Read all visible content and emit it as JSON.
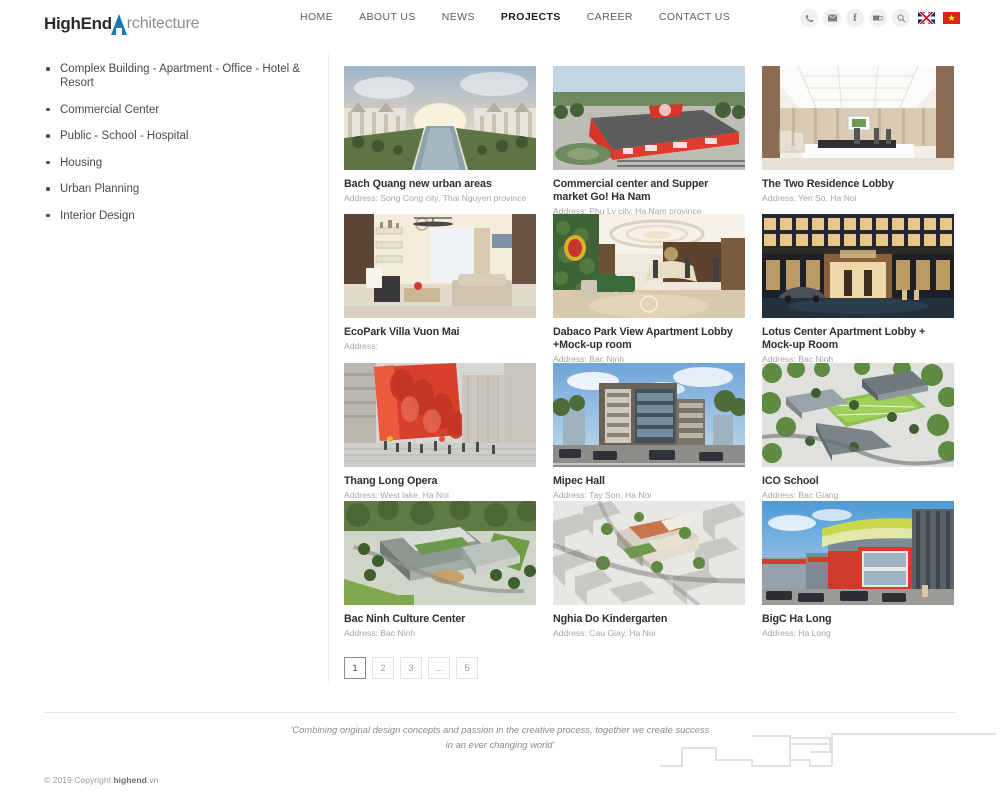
{
  "site": {
    "logo_primary": "HighEnd",
    "logo_secondary": "rchitecture",
    "logo_mark": "blue-triangle-a"
  },
  "nav": {
    "items": [
      {
        "label": "HOME",
        "active": false
      },
      {
        "label": "ABOUT US",
        "active": false
      },
      {
        "label": "NEWS",
        "active": false
      },
      {
        "label": "PROJECTS",
        "active": true
      },
      {
        "label": "CAREER",
        "active": false
      },
      {
        "label": "CONTACT US",
        "active": false
      }
    ]
  },
  "toolbar": {
    "icons": [
      {
        "name": "phone-icon",
        "glyph": "☎"
      },
      {
        "name": "email-icon",
        "glyph": "✉"
      },
      {
        "name": "facebook-icon",
        "glyph": "f"
      },
      {
        "name": "social-share-icon",
        "glyph": "✉"
      },
      {
        "name": "search-icon",
        "glyph": "⌕"
      }
    ],
    "flags": [
      {
        "name": "flag-en",
        "label": "EN"
      },
      {
        "name": "flag-vi",
        "label": "VI",
        "star": "★"
      }
    ]
  },
  "sidebar": {
    "items": [
      {
        "label": "Complex Building - Apartment - Office - Hotel & Resort"
      },
      {
        "label": "Commercial Center"
      },
      {
        "label": "Public - School - Hospital"
      },
      {
        "label": "Housing"
      },
      {
        "label": "Urban Planning"
      },
      {
        "label": "Interior Design"
      }
    ]
  },
  "projects": [
    {
      "title": "Bach Quang new urban areas",
      "address": "Address: Song Cong city, Thai Nguyen province",
      "image": "urban-boulevard-render"
    },
    {
      "title": "Commercial center and Supper market Go! Ha Nam",
      "address": "Address: Phu Ly city, Ha Nam province",
      "image": "red-shopping-mall-aerial"
    },
    {
      "title": "The Two Residence Lobby",
      "address": "Address: Yen So, Ha Noi",
      "image": "bright-reception-lobby"
    },
    {
      "title": "EcoPark Villa Vuon Mai",
      "address": "Address:",
      "image": "living-room-interior"
    },
    {
      "title": "Dabaco Park View Apartment Lobby +Mock-up room",
      "address": "Address: Bac Ninh",
      "image": "green-wall-lobby"
    },
    {
      "title": "Lotus Center Apartment Lobby + Mock-up Room",
      "address": "Address: Bac Ninh",
      "image": "night-building-facade"
    },
    {
      "title": "Thang Long Opera",
      "address": "Address: West lake, Ha Noi",
      "image": "red-opera-house"
    },
    {
      "title": "Mipec Hall",
      "address": "Address: Tay Son, Ha Noi",
      "image": "grey-office-building"
    },
    {
      "title": "ICO School",
      "address": "Address: Bac Giang",
      "image": "school-campus-aerial"
    },
    {
      "title": "Bac Ninh Culture Center",
      "address": "Address: Bac Ninh",
      "image": "culture-center-aerial"
    },
    {
      "title": "Nghia Do Kindergarten",
      "address": "Address: Cau Giay, Ha Noi",
      "image": "kindergarten-block-aerial"
    },
    {
      "title": "BigC Ha Long",
      "address": "Address: Ha Long",
      "image": "bigc-storefront"
    }
  ],
  "pagination": {
    "pages": [
      {
        "label": "1",
        "active": true
      },
      {
        "label": "2",
        "active": false
      },
      {
        "label": "3",
        "active": false
      },
      {
        "label": "...",
        "active": false
      },
      {
        "label": "5",
        "active": false
      }
    ]
  },
  "footer": {
    "tagline_line1": "'Combining original design concepts and passion in the creative process, together we create success",
    "tagline_line2": "in an ever changing world'",
    "copyright_prefix": "© 2019 Copyright ",
    "copyright_brand": "highend",
    "copyright_suffix": ".vn"
  },
  "colors": {
    "logo_blue": "#1579b8",
    "flag_red": "#da251d",
    "flag_star": "#ffff00",
    "active_nav": "#1c1c1c"
  }
}
